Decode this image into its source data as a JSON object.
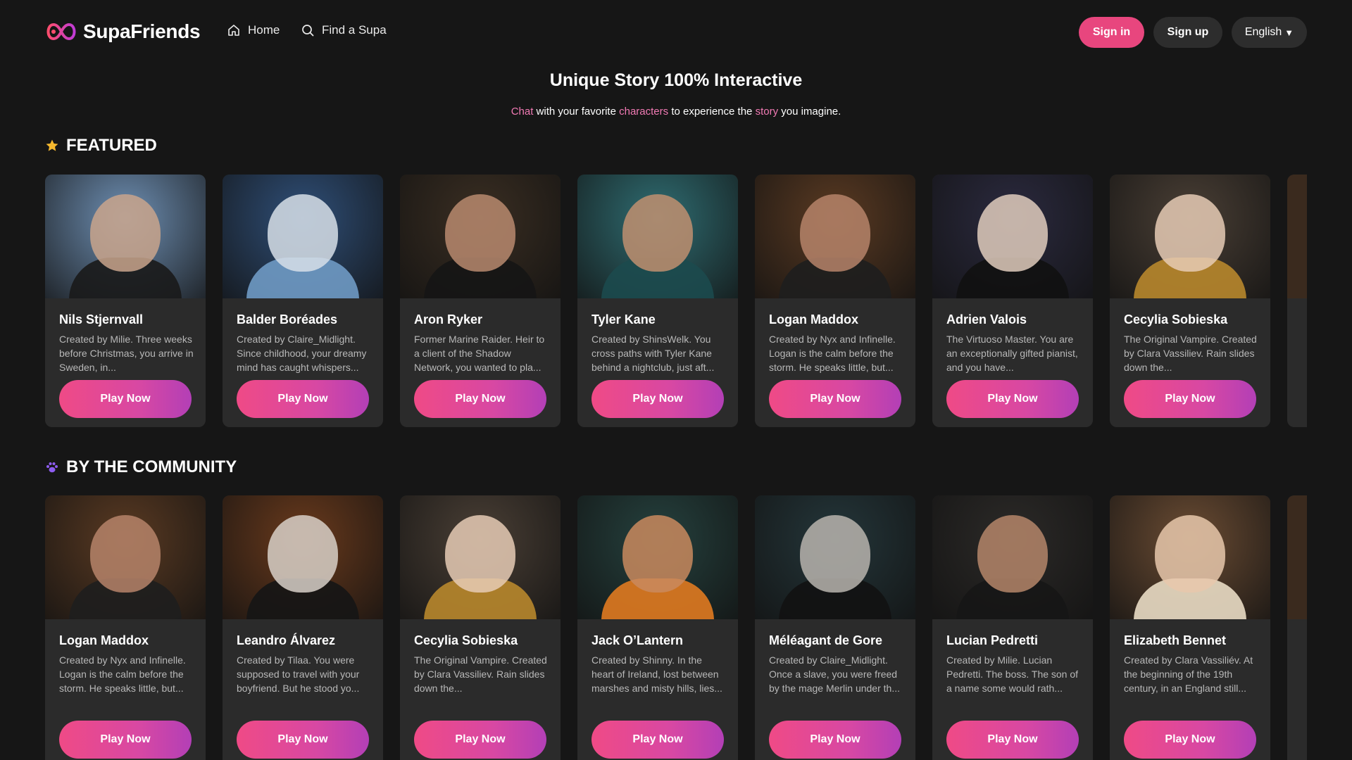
{
  "header": {
    "logo_text": "SupaFriends",
    "nav": [
      {
        "label": "Home",
        "icon": "home-icon"
      },
      {
        "label": "Find a Supa",
        "icon": "search-icon"
      }
    ],
    "sign_in": "Sign in",
    "sign_up": "Sign up",
    "language": "English"
  },
  "hero": {
    "title": "Unique Story 100% Interactive",
    "sub": {
      "w1": "Chat",
      "t1": "with your favorite",
      "w2": "characters",
      "t2": "to experience the",
      "w3": "story",
      "t3": "you imagine."
    }
  },
  "featured": {
    "title": "FEATURED",
    "cards": [
      {
        "name": "Nils Stjernvall",
        "desc": "Created by Milie. Three weeks before Christmas, you arrive in Sweden, in...",
        "button": "Play Now",
        "bg": "#6e8fb3",
        "skin": "#c9a48c",
        "cloth": "#1a1a1a"
      },
      {
        "name": "Balder Boréades",
        "desc": "Created by Claire_Midlight. Since childhood, your dreamy mind has caught whispers...",
        "button": "Play Now",
        "bg": "#2f4f78",
        "skin": "#d7dfe8",
        "cloth": "#6f9ac4"
      },
      {
        "name": "Aron Ryker",
        "desc": "Former Marine Raider. Heir to a client of the Shadow Network, you wanted to pla...",
        "button": "Play Now",
        "bg": "#3a2e22",
        "skin": "#b88a6e",
        "cloth": "#151515"
      },
      {
        "name": "Tyler Kane",
        "desc": "Created by ShinsWelk. You cross paths with Tyler Kane behind a nightclub, just aft...",
        "button": "Play Now",
        "bg": "#2f6d72",
        "skin": "#c08f70",
        "cloth": "#1c4a4e"
      },
      {
        "name": "Logan Maddox",
        "desc": "Created by Nyx and Infinelle. Logan is the calm before the storm. He speaks little, but...",
        "button": "Play Now",
        "bg": "#5a3a22",
        "skin": "#b6846a",
        "cloth": "#1e1e1e"
      },
      {
        "name": "Adrien Valois",
        "desc": "The Virtuoso Master. You are an exceptionally gifted pianist, and you have...",
        "button": "Play Now",
        "bg": "#2b2a3f",
        "skin": "#e0cdbd",
        "cloth": "#111111"
      },
      {
        "name": "Cecylia Sobieska",
        "desc": "The Original Vampire. Created by Clara Vassiliev. Rain slides down the...",
        "button": "Play Now",
        "bg": "#4a3f35",
        "skin": "#e6cbb5",
        "cloth": "#b8872c"
      }
    ]
  },
  "community": {
    "title": "BY THE COMMUNITY",
    "cards": [
      {
        "name": "Logan Maddox",
        "desc": "Created by Nyx and Infinelle. Logan is the calm before the storm. He speaks little, but...",
        "button": "Play Now",
        "bg": "#5a3a22",
        "skin": "#b6846a",
        "cloth": "#1e1e1e"
      },
      {
        "name": "Leandro Álvarez",
        "desc": "Created by Tilaa. You were supposed to travel with your boyfriend. But he stood yo...",
        "button": "Play Now",
        "bg": "#6a3a1c",
        "skin": "#d8d0c8",
        "cloth": "#151515"
      },
      {
        "name": "Cecylia Sobieska",
        "desc": "The Original Vampire. Created by Clara Vassiliev. Rain slides down the...",
        "button": "Play Now",
        "bg": "#4a3f35",
        "skin": "#e6cbb5",
        "cloth": "#b8872c"
      },
      {
        "name": "Jack O’Lantern",
        "desc": "Created by Shinny. In the heart of Ireland, lost between marshes and misty hills, lies...",
        "button": "Play Now",
        "bg": "#25413e",
        "skin": "#c98a5e",
        "cloth": "#e07a20"
      },
      {
        "name": "Méléagant de Gore",
        "desc": "Created by Claire_Midlight. Once a slave, you were freed by the mage Merlin under th...",
        "button": "Play Now",
        "bg": "#24363a",
        "skin": "#b9b4ae",
        "cloth": "#121212"
      },
      {
        "name": "Lucian Pedretti",
        "desc": "Created by Milie. Lucian Pedretti. The boss. The son of a name some would rath...",
        "button": "Play Now",
        "bg": "#2c2a28",
        "skin": "#b5866a",
        "cloth": "#161616"
      },
      {
        "name": "Elizabeth Bennet",
        "desc": "Created by Clara Vassiliév. At the beginning of the 19th century, in an England still...",
        "button": "Play Now",
        "bg": "#6b4c33",
        "skin": "#e8c8ac",
        "cloth": "#e9dcc4"
      }
    ]
  }
}
